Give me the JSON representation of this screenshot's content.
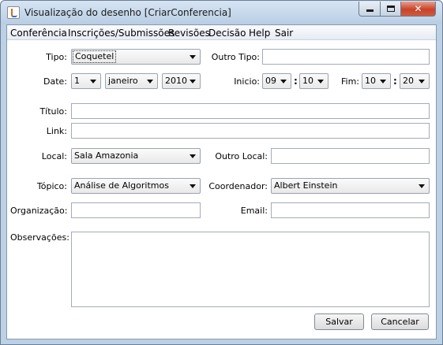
{
  "window": {
    "title": "Visualização do desenho [CriarConferencia]"
  },
  "menubar": [
    "Conferência",
    "Inscrições/Submissões",
    "Revisões",
    "Decisão",
    "Help",
    "Sair"
  ],
  "form": {
    "tipo": {
      "label": "Tipo:",
      "value": "Coquetel"
    },
    "outro_tipo": {
      "label": "Outro Tipo:",
      "value": ""
    },
    "date": {
      "label": "Date:",
      "day": "1",
      "month": "janeiro",
      "year": "2010"
    },
    "inicio": {
      "label": "Inicio:",
      "hour": "09",
      "minute": "10",
      "sep": ":"
    },
    "fim": {
      "label": "Fim:",
      "hour": "10",
      "minute": "20",
      "sep": ":"
    },
    "titulo": {
      "label": "Título:",
      "value": ""
    },
    "link": {
      "label": "Link:",
      "value": ""
    },
    "local": {
      "label": "Local:",
      "value": "Sala Amazonia"
    },
    "outro_local": {
      "label": "Outro Local:",
      "value": ""
    },
    "topico": {
      "label": "Tópico:",
      "value": "Análise de Algoritmos"
    },
    "coordenador": {
      "label": "Coordenador:",
      "value": "Albert Einstein"
    },
    "organizacao": {
      "label": "Organização:",
      "value": ""
    },
    "email": {
      "label": "Email:",
      "value": ""
    },
    "observacoes": {
      "label": "Observações:",
      "value": ""
    }
  },
  "buttons": {
    "save": "Salvar",
    "cancel": "Cancelar"
  },
  "icons": {
    "app": "java-app-icon",
    "minimize": "minimize-icon",
    "maximize": "maximize-icon",
    "close": "close-icon"
  }
}
